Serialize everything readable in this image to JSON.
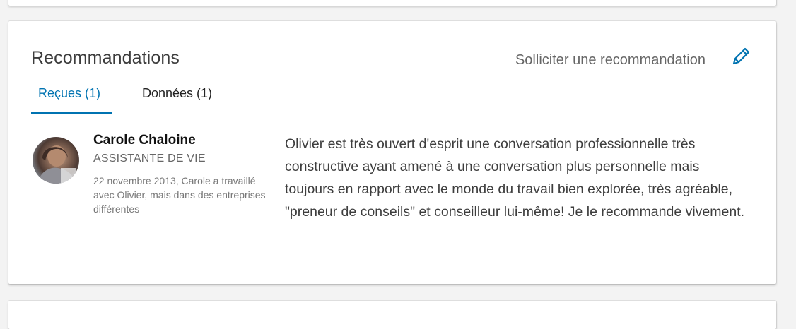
{
  "section": {
    "title": "Recommandations",
    "request_label": "Solliciter une recommandation",
    "edit_icon": "pencil-icon"
  },
  "tabs": [
    {
      "label": "Reçues (1)",
      "active": true
    },
    {
      "label": "Données (1)",
      "active": false
    }
  ],
  "recommendation": {
    "author_name": "Carole Chaloine",
    "author_title": "ASSISTANTE DE VIE",
    "meta": "22 novembre 2013, Carole a travaillé avec Olivier, mais dans des entreprises différentes",
    "text": "Olivier est très ouvert d'esprit une conversation professionnelle très constructive ayant amené à une conversation plus personnelle mais toujours en rapport avec le monde du travail bien explorée, très agréable, \"preneur de conseils\" et conseilleur lui-même! Je le recommande vivement."
  },
  "colors": {
    "accent": "#0073b1",
    "background": "#f3f3f3"
  }
}
